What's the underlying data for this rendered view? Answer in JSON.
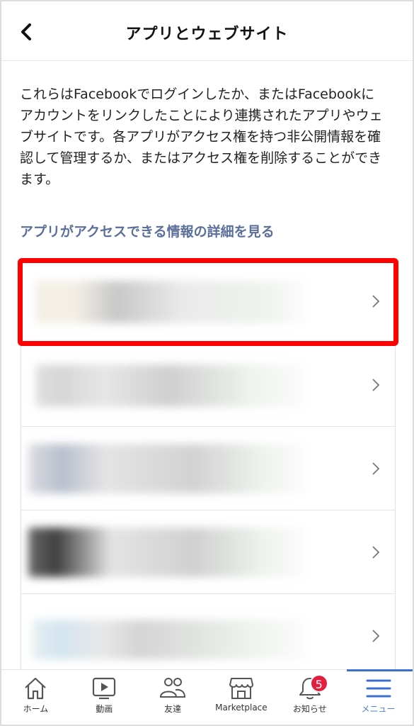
{
  "header": {
    "title": "アプリとウェブサイト",
    "back_icon": "chevron-left-icon"
  },
  "description": "これらはFacebookでログインしたか、またはFacebookにアカウントをリンクしたことにより連携されたアプリやウェブサイトです。各アプリがアクセス権を持つ非公開情報を確認して管理するか、またはアクセス権を削除することができます。",
  "details_link": "アプリがアクセスできる情報の詳細を見る",
  "apps": [
    {
      "name": "",
      "highlighted": true,
      "blur_colors": [
        "#f3efe6",
        "#c8c8c8",
        "#eef3ee"
      ]
    },
    {
      "name": "",
      "highlighted": false,
      "blur_colors": [
        "#d6d6d6",
        "#cfcfcf",
        "#eef3ee"
      ]
    },
    {
      "name": "",
      "highlighted": false,
      "blur_colors": [
        "#b8bfcc",
        "#d2d2d2",
        "#eef3ee"
      ]
    },
    {
      "name": "",
      "highlighted": false,
      "blur_colors": [
        "#3f3f3f",
        "#d0d0d0",
        "#eef3ee"
      ]
    },
    {
      "name": "",
      "highlighted": false,
      "blur_colors": [
        "#d3e5ef",
        "#d4d4d4",
        "#eef3ee"
      ]
    }
  ],
  "tabbar": {
    "items": [
      {
        "label": "ホーム",
        "icon": "home-icon"
      },
      {
        "label": "動画",
        "icon": "video-icon"
      },
      {
        "label": "友達",
        "icon": "friends-icon"
      },
      {
        "label": "Marketplace",
        "icon": "marketplace-icon"
      },
      {
        "label": "お知らせ",
        "icon": "bell-icon",
        "badge": "5"
      },
      {
        "label": "メニュー",
        "icon": "menu-icon",
        "active": true
      }
    ]
  },
  "colors": {
    "link": "#5b6f9a",
    "highlight": "#ff0000",
    "badge": "#e41e3f",
    "active_tab": "#3a6fd1"
  }
}
